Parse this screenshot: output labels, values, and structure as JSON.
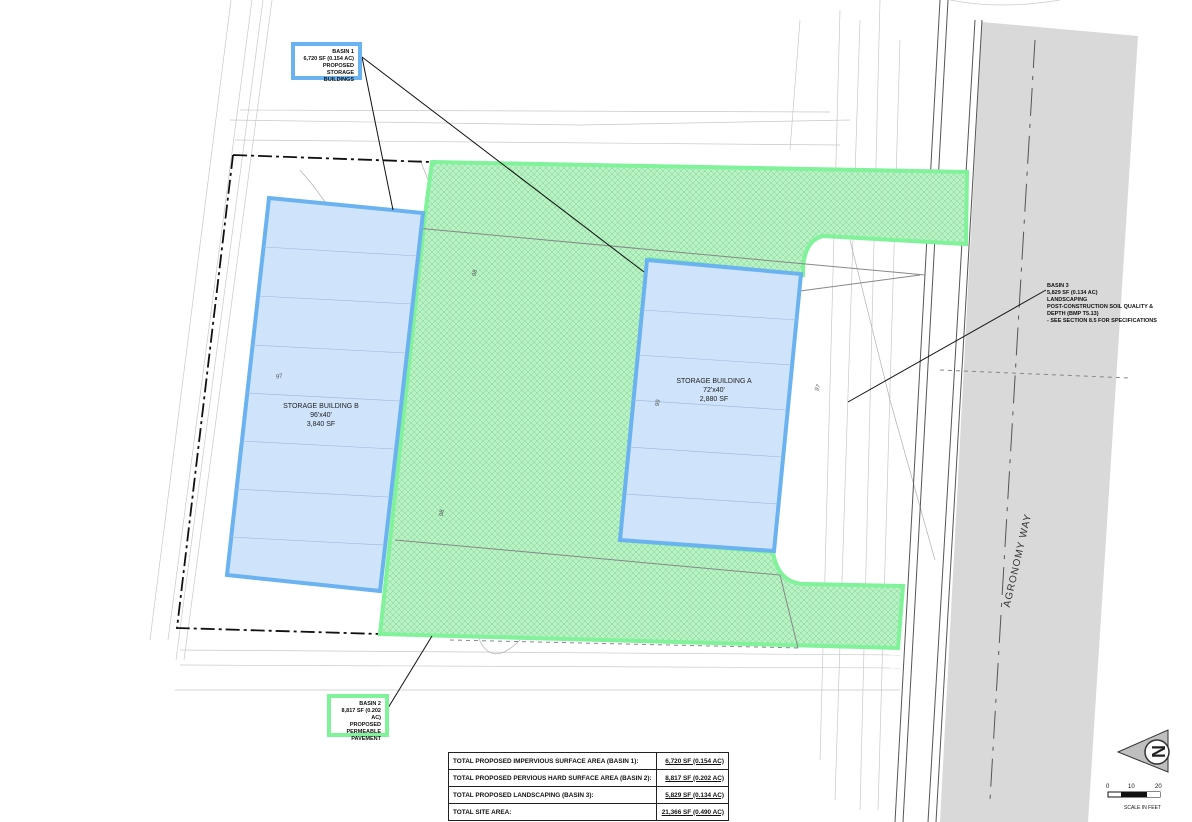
{
  "street_name": "AGRONOMY WAY",
  "basin1": {
    "title": "BASIN 1",
    "area": "6,720 SF (0.154 AC)",
    "description_lines": [
      "PROPOSED STORAGE",
      "BUILDINGS"
    ],
    "color": "#6ab3f0"
  },
  "basin2": {
    "title": "BASIN 2",
    "area": "8,817 SF (0.202 AC)",
    "description_lines": [
      "PROPOSED",
      "PERMEABLE",
      "PAVEMENT"
    ],
    "color": "#7ff29a"
  },
  "basin3": {
    "title": "BASIN 3",
    "area": "5,829 SF (0.134 AC)",
    "description_lines": [
      "LANDSCAPING",
      "POST-CONSTRUCTION SOIL QUALITY &",
      "DEPTH (BMP T5.13)",
      "- SEE SECTION 8.5 FOR SPECIFICATIONS"
    ]
  },
  "buildings": [
    {
      "name": "STORAGE BUILDING B",
      "dimensions": "96'x40'",
      "area": "3,840 SF"
    },
    {
      "name": "STORAGE BUILDING A",
      "dimensions": "72'x40'",
      "area": "2,880 SF"
    }
  ],
  "summary_table": [
    {
      "label": "TOTAL PROPOSED IMPERVIOUS SURFACE AREA (BASIN 1):",
      "value": "6,720 SF (0.154 AC)"
    },
    {
      "label": "TOTAL PROPOSED PERVIOUS HARD SURFACE AREA (BASIN 2):",
      "value": "8,817 SF (0.202 AC)"
    },
    {
      "label": "TOTAL PROPOSED LANDSCAPING (BASIN 3):",
      "value": "5,829 SF (0.134 AC)"
    },
    {
      "label": "TOTAL SITE AREA:",
      "value": "21,366 SF (0.490 AC)"
    }
  ],
  "scale": {
    "ticks": [
      "0",
      "10",
      "20"
    ],
    "label": "SCALE IN FEET"
  },
  "north_arrow_letter": "N",
  "contour_labels": [
    "97",
    "98",
    "99",
    "98",
    "97"
  ],
  "colors": {
    "building_fill": "#cfe3fb",
    "building_stroke": "#6ab3f0",
    "paving_fill": "#b8f2c4",
    "paving_stroke": "#7ff29a",
    "road": "#d9d9d9"
  }
}
